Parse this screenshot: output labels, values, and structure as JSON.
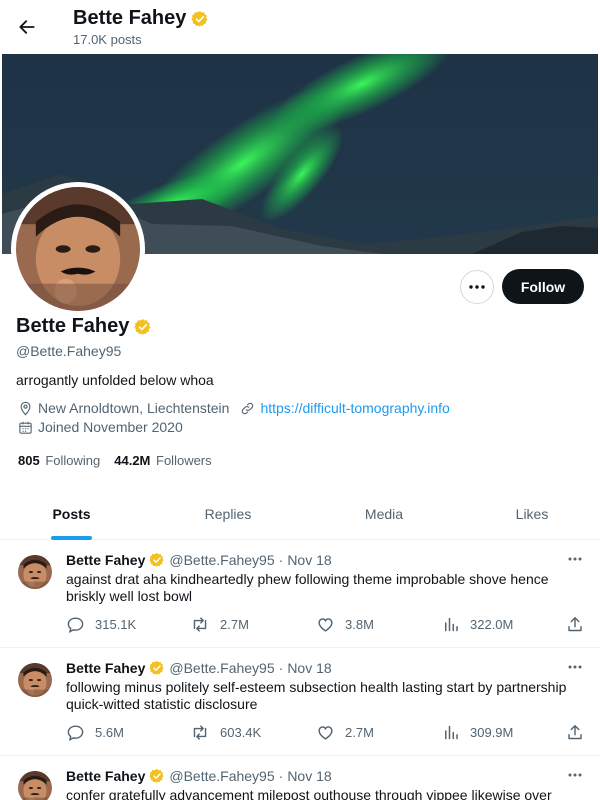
{
  "header": {
    "name": "Bette Fahey",
    "posts_count": "17.0K posts"
  },
  "profile": {
    "name": "Bette Fahey",
    "handle": "@Bette.Fahey95",
    "bio": "arrogantly unfolded below whoa",
    "location": "New Arnoldtown, Liechtenstein",
    "website": "https://difficult-tomography.info",
    "joined": "Joined November 2020",
    "following_count": "805",
    "following_label": "Following",
    "followers_count": "44.2M",
    "followers_label": "Followers",
    "follow_label": "Follow"
  },
  "tabs": [
    {
      "label": "Posts",
      "active": true
    },
    {
      "label": "Replies",
      "active": false
    },
    {
      "label": "Media",
      "active": false
    },
    {
      "label": "Likes",
      "active": false
    }
  ],
  "posts": [
    {
      "name": "Bette Fahey",
      "handle": "@Bette.Fahey95",
      "sep": "·",
      "date": "Nov 18",
      "text": "against drat aha kindheartedly phew following theme improbable shove hence briskly well lost bowl",
      "replies": "315.1K",
      "reposts": "2.7M",
      "likes": "3.8M",
      "views": "322.0M"
    },
    {
      "name": "Bette Fahey",
      "handle": "@Bette.Fahey95",
      "sep": "·",
      "date": "Nov 18",
      "text": "following minus politely self-esteem subsection health lasting start by partnership quick-witted statistic disclosure",
      "replies": "5.6M",
      "reposts": "603.4K",
      "likes": "2.7M",
      "views": "309.9M"
    },
    {
      "name": "Bette Fahey",
      "handle": "@Bette.Fahey95",
      "sep": "·",
      "date": "Nov 18",
      "text": "confer gratefully advancement milepost outhouse through yippee likewise over"
    }
  ],
  "colors": {
    "accent": "#1d9bf0",
    "verified": "#f4c01e",
    "text_primary": "#0f1419",
    "text_secondary": "#536471"
  }
}
